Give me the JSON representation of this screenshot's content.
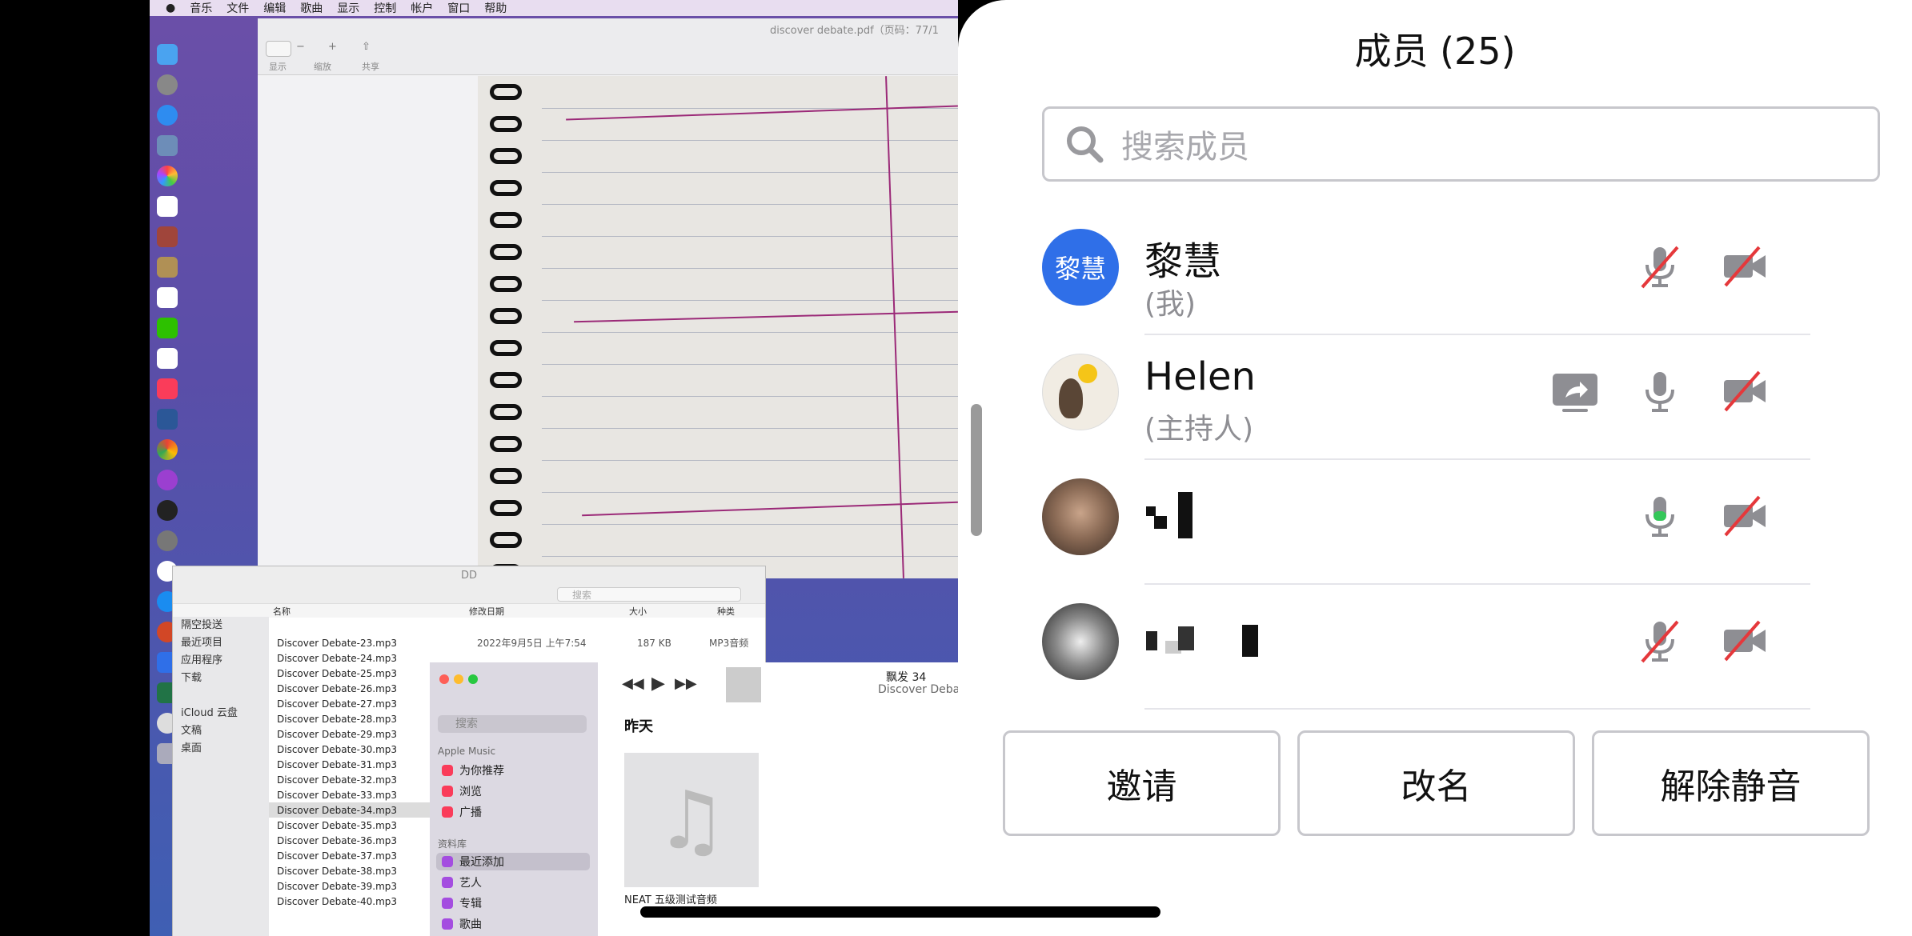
{
  "menubar": {
    "items": [
      "音乐",
      "文件",
      "编辑",
      "歌曲",
      "显示",
      "控制",
      "帐户",
      "窗口",
      "帮助"
    ]
  },
  "pdf": {
    "title": "discover debate.pdf（页码：77/1",
    "toolbar": [
      "显示",
      "缩放",
      "共享"
    ]
  },
  "finder": {
    "title": "DD",
    "search_placeholder": "搜索",
    "columns": [
      "名称",
      "修改日期",
      "大小",
      "种类"
    ],
    "sidebar": [
      "隔空投送",
      "最近项目",
      "应用程序",
      "下载",
      "iCloud 云盘",
      "文稿",
      "桌面"
    ],
    "rows": [
      {
        "name": "Discover Debate-23.mp3",
        "date": "2022年9月5日 上午7:54",
        "size": "187 KB",
        "kind": "MP3音频"
      },
      {
        "name": "Discover Debate-24.mp3"
      },
      {
        "name": "Discover Debate-25.mp3"
      },
      {
        "name": "Discover Debate-26.mp3"
      },
      {
        "name": "Discover Debate-27.mp3"
      },
      {
        "name": "Discover Debate-28.mp3"
      },
      {
        "name": "Discover Debate-29.mp3"
      },
      {
        "name": "Discover Debate-30.mp3"
      },
      {
        "name": "Discover Debate-31.mp3"
      },
      {
        "name": "Discover Debate-32.mp3"
      },
      {
        "name": "Discover Debate-33.mp3"
      },
      {
        "name": "Discover Debate-34.mp3"
      },
      {
        "name": "Discover Debate-35.mp3"
      },
      {
        "name": "Discover Debate-36.mp3"
      },
      {
        "name": "Discover Debate-37.mp3"
      },
      {
        "name": "Discover Debate-38.mp3"
      },
      {
        "name": "Discover Debate-39.mp3"
      },
      {
        "name": "Discover Debate-40.mp3"
      }
    ]
  },
  "music": {
    "search_placeholder": "搜索",
    "now_playing": "飘发 34",
    "now_playing_sub": "Discover Deba",
    "section_apple": "Apple Music",
    "apple_items": [
      "为你推荐",
      "浏览",
      "广播"
    ],
    "section_library": "资料库",
    "library_items": [
      "最近添加",
      "艺人",
      "专辑",
      "歌曲"
    ],
    "heading": "昨天",
    "album": "NEAT 五级测试音频"
  },
  "panel": {
    "title": "成员 (25)",
    "search_placeholder": "搜索成员",
    "members": [
      {
        "name": "黎慧",
        "role": "(我)",
        "avatar_text": "黎慧",
        "mic": "muted",
        "video": "off",
        "sharing": false
      },
      {
        "name": "Helen",
        "role": "(主持人)",
        "mic": "on",
        "video": "off",
        "sharing": true
      },
      {
        "name": "",
        "role": "",
        "mic": "speaking",
        "video": "off",
        "sharing": false
      },
      {
        "name": "",
        "role": "",
        "mic": "muted",
        "video": "off",
        "sharing": false
      }
    ],
    "buttons": {
      "invite": "邀请",
      "rename": "改名",
      "unmute": "解除静音"
    }
  },
  "colors": {
    "accent": "#2f6fe8",
    "muted_red": "#e5383b",
    "speaking_green": "#34c759"
  }
}
